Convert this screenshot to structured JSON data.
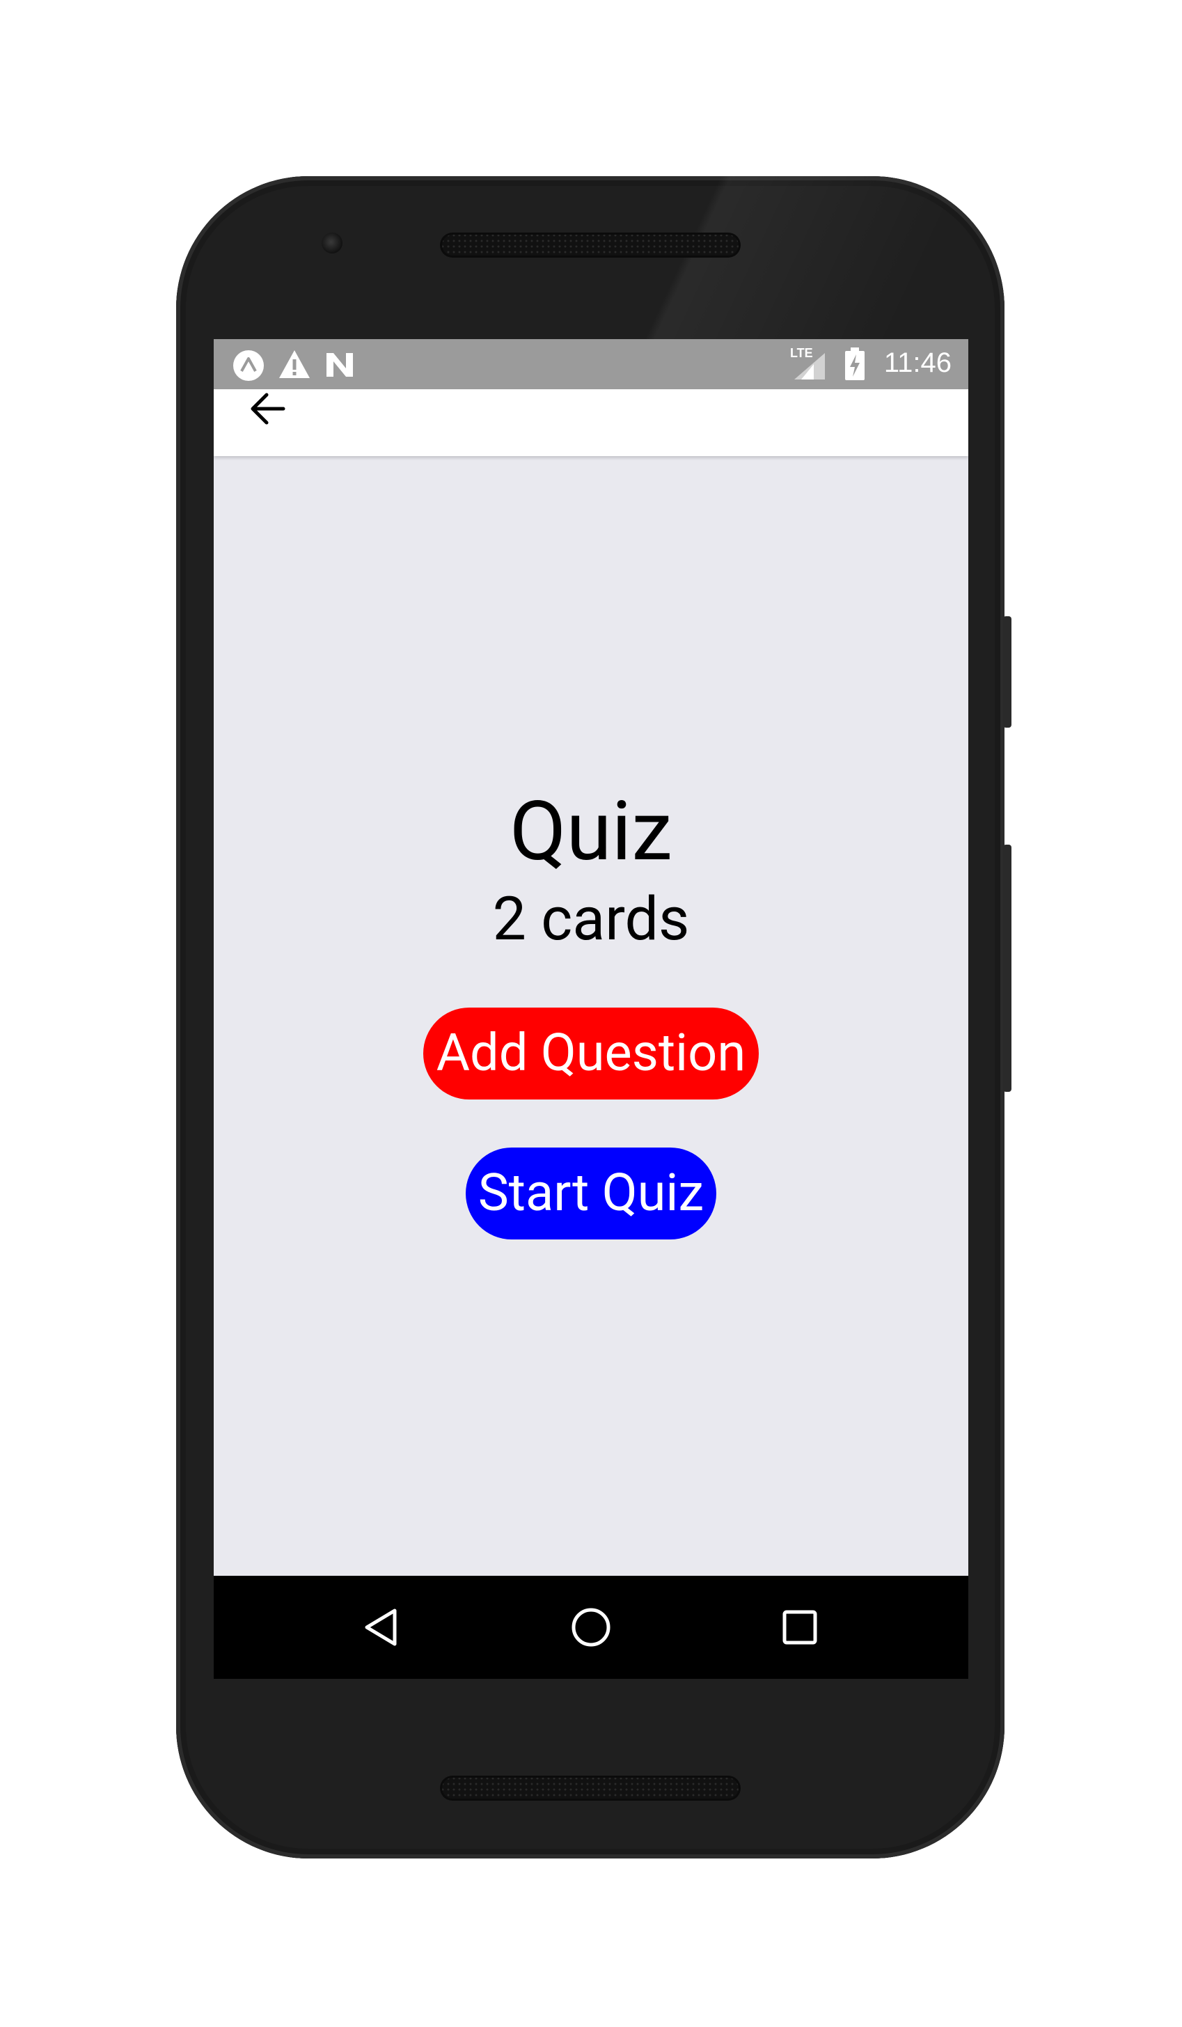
{
  "status_bar": {
    "time": "11:46",
    "network_label": "LTE",
    "icons": [
      "expo-icon",
      "warning-icon",
      "n-icon",
      "signal-icon",
      "battery-charging-icon"
    ]
  },
  "header": {
    "back_icon": "arrow-left-icon"
  },
  "deck": {
    "title": "Quiz",
    "card_count": "2 cards"
  },
  "actions": {
    "add_question": "Add Question",
    "start_quiz": "Start Quiz"
  },
  "nav_bar": {
    "icons": [
      "back-triangle-icon",
      "home-circle-icon",
      "recents-square-icon"
    ]
  },
  "colors": {
    "add_button": "#ff0000",
    "start_button": "#0000ff",
    "screen_background": "#e9e9ef",
    "status_bar": "#9b9b9b"
  }
}
